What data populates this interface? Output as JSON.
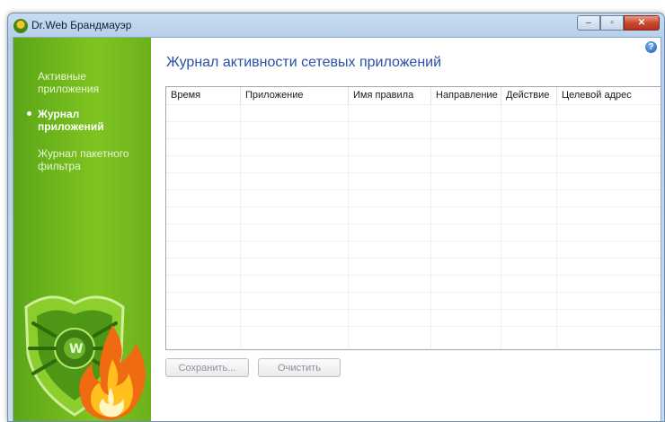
{
  "window": {
    "title": "Dr.Web Брандмауэр"
  },
  "caption": {
    "minimize": "–",
    "maximize": "▫",
    "close": "✕"
  },
  "sidebar": {
    "items": [
      {
        "label": "Активные приложения",
        "active": false
      },
      {
        "label": "Журнал приложений",
        "active": true
      },
      {
        "label": "Журнал пакетного фильтра",
        "active": false
      }
    ]
  },
  "main": {
    "help": "?",
    "title": "Журнал активности сетевых приложений",
    "table": {
      "columns": [
        "Время",
        "Приложение",
        "Имя правила",
        "Направление",
        "Действие",
        "Целевой адрес"
      ],
      "rows": []
    },
    "buttons": {
      "save": "Сохранить...",
      "clear": "Очистить"
    }
  },
  "colors": {
    "sidebar_green": "#7fc420",
    "title_blue": "#2a4fa8",
    "flame": "#f06a12"
  },
  "icons": [
    "app-icon",
    "help-icon",
    "drweb-spider-shield-icon",
    "flame-icon"
  ]
}
